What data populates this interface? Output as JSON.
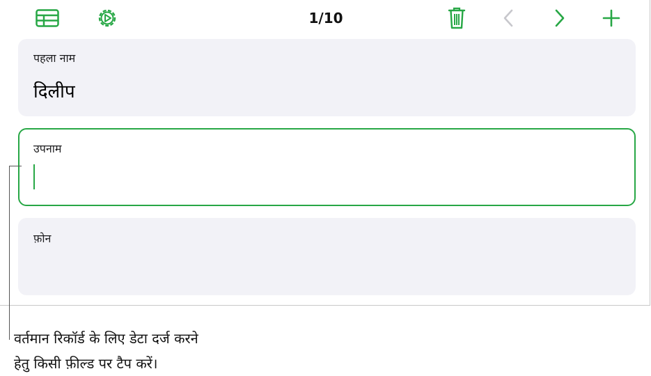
{
  "toolbar": {
    "counter": "1/10",
    "icons": {
      "table": "table-icon",
      "settings": "settings-icon",
      "delete": "trash-icon",
      "prev": "chevron-left-icon",
      "next": "chevron-right-icon",
      "add": "plus-icon"
    },
    "accent": "#27a745",
    "disabled": "#c7c7cc"
  },
  "fields": [
    {
      "label": "पहला नाम",
      "value": "दिलीप"
    },
    {
      "label": "उपनाम",
      "value": ""
    },
    {
      "label": "फ़ोन",
      "value": ""
    }
  ],
  "callout": {
    "line1": "वर्तमान रिकॉर्ड के लिए डेटा दर्ज करने",
    "line2": "हेतु किसी फ़ील्ड पर टैप करें।"
  }
}
